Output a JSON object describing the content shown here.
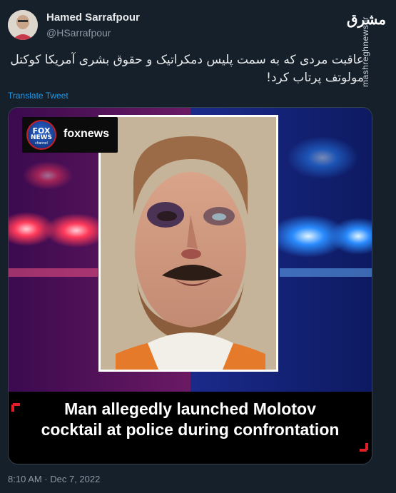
{
  "author": {
    "name": "Hamed Sarrafpour",
    "handle": "@HSarrafpour"
  },
  "watermark": {
    "logo_text": "مشرق",
    "site": "mashreghnews.ir"
  },
  "tweet": {
    "text": "عاقبت مردی که به سمت پلیس دمکراتیک و حقوق بشری آمریکا کوکتل مولوتف پرتاب کرد!",
    "translate_label": "Translate Tweet",
    "timestamp": "8:10 AM · Dec 7, 2022"
  },
  "media": {
    "channel_label": "foxnews",
    "logo": {
      "line1": "FOX",
      "line2": "NEWS",
      "line3": "channel"
    },
    "caption_line1": "Man allegedly launched Molotov",
    "caption_line2": "cocktail at police during confrontation"
  }
}
